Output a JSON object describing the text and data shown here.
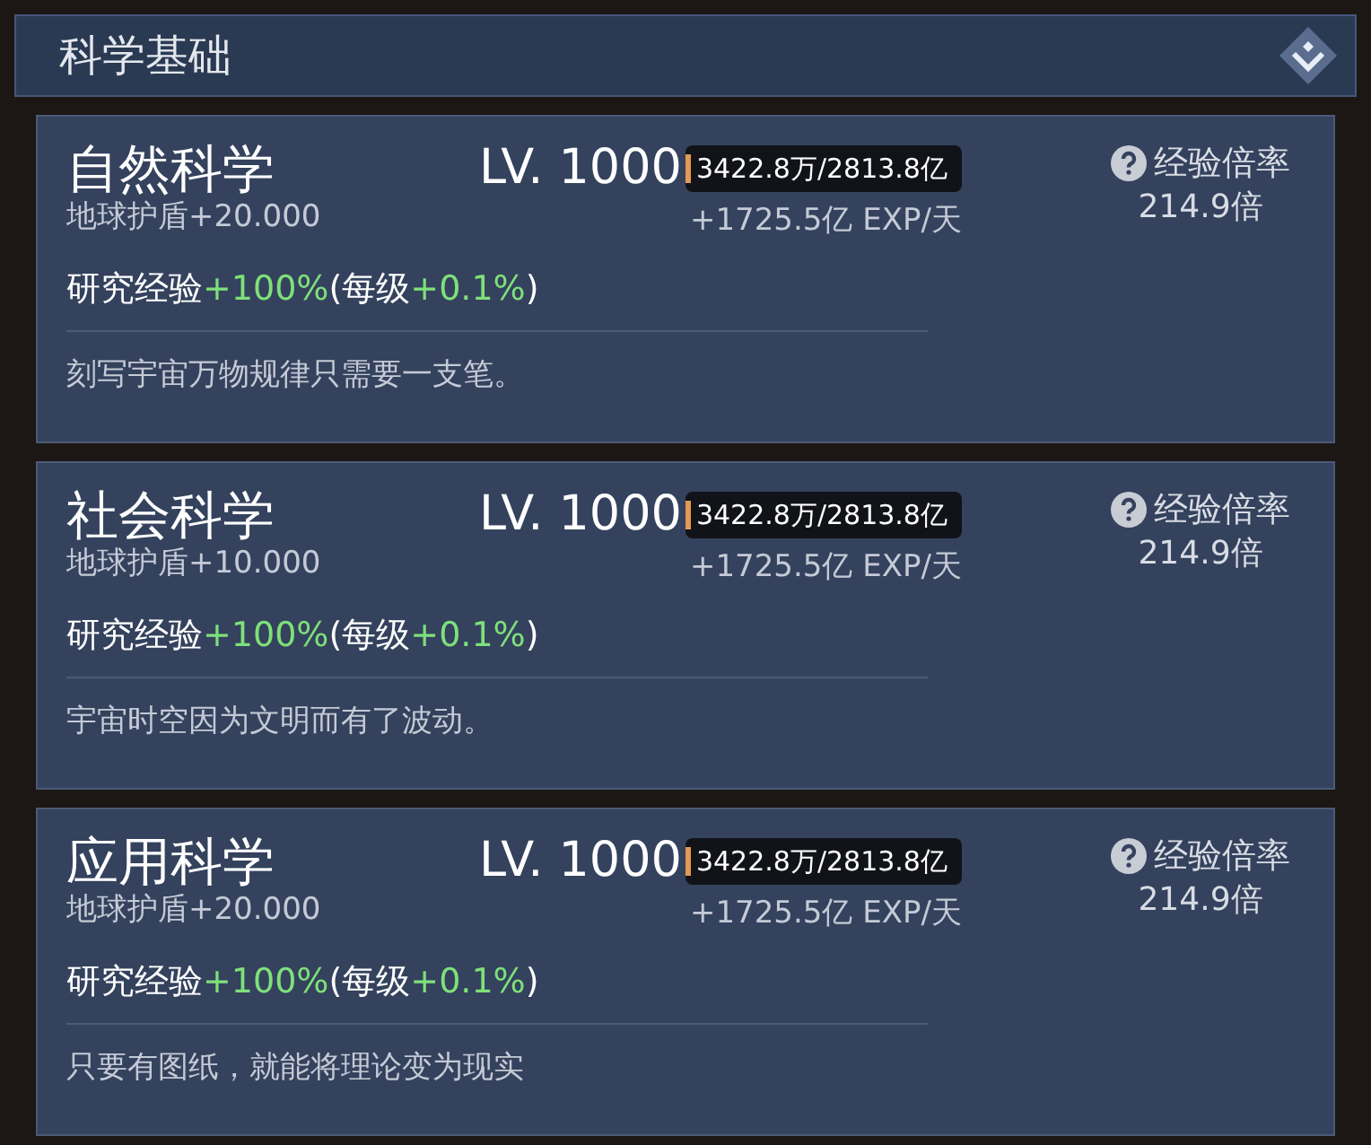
{
  "header": {
    "title": "科学基础"
  },
  "cards": [
    {
      "name": "自然科学",
      "bonus": "地球护盾+20.000",
      "level_text": "LV. 1000",
      "progress": {
        "text": "3422.8万/2813.8亿",
        "level": 0.015
      },
      "rate": "+1725.5亿 EXP/天",
      "multiplier_label": "经验倍率",
      "multiplier": "214.9倍",
      "research": {
        "label": "研究经验",
        "bonus": "+100%",
        "open": "(每级",
        "per_level": "+0.1%",
        "close": ")"
      },
      "description": "刻写宇宙万物规律只需要一支笔。"
    },
    {
      "name": "社会科学",
      "bonus": "地球护盾+10.000",
      "level_text": "LV. 1000",
      "progress": {
        "text": "3422.8万/2813.8亿",
        "level": 0.015
      },
      "rate": "+1725.5亿 EXP/天",
      "multiplier_label": "经验倍率",
      "multiplier": "214.9倍",
      "research": {
        "label": "研究经验",
        "bonus": "+100%",
        "open": "(每级",
        "per_level": "+0.1%",
        "close": ")"
      },
      "description": "宇宙时空因为文明而有了波动。"
    },
    {
      "name": "应用科学",
      "bonus": "地球护盾+20.000",
      "level_text": "LV. 1000",
      "progress": {
        "text": "3422.8万/2813.8亿",
        "level": 0.015
      },
      "rate": "+1725.5亿 EXP/天",
      "multiplier_label": "经验倍率",
      "multiplier": "214.9倍",
      "research": {
        "label": "研究经验",
        "bonus": "+100%",
        "open": "(每级",
        "per_level": "+0.1%",
        "close": ")"
      },
      "description": "只要有图纸，就能将理论变为现实"
    }
  ]
}
